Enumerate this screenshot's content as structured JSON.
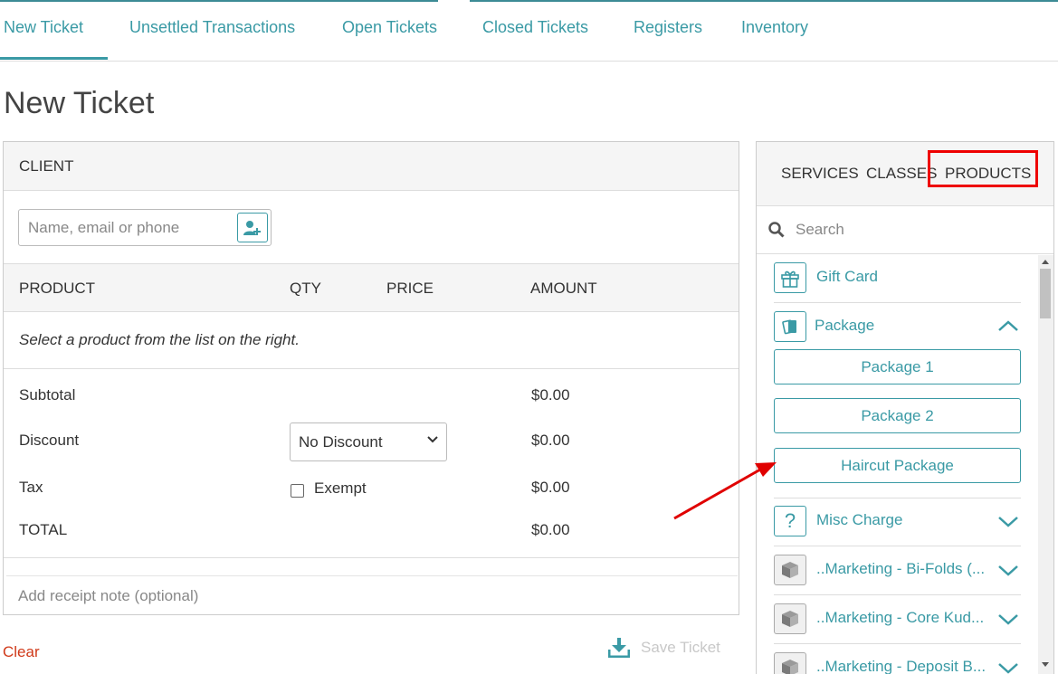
{
  "nav": {
    "tabs": [
      {
        "label": "New Ticket",
        "active": true
      },
      {
        "label": "Unsettled Transactions"
      },
      {
        "label": "Open Tickets"
      },
      {
        "label": "Closed Tickets"
      },
      {
        "label": "Registers"
      },
      {
        "label": "Inventory"
      }
    ]
  },
  "page": {
    "title": "New Ticket"
  },
  "client": {
    "header": "CLIENT",
    "search_placeholder": "Name, email or phone",
    "add_client_icon": "add-user-icon"
  },
  "table": {
    "columns": [
      "PRODUCT",
      "QTY",
      "PRICE",
      "AMOUNT"
    ],
    "empty_message": "Select a product from the list on the right."
  },
  "summary": {
    "subtotal_label": "Subtotal",
    "subtotal_value": "$0.00",
    "discount_label": "Discount",
    "discount_selected": "No Discount",
    "discount_value": "$0.00",
    "tax_label": "Tax",
    "exempt_label": "Exempt",
    "exempt_checked": false,
    "tax_value": "$0.00",
    "total_label": "TOTAL",
    "total_value": "$0.00"
  },
  "receipt": {
    "placeholder": "Add receipt note (optional)"
  },
  "actions": {
    "clear": "Clear",
    "save_ticket": "Save Ticket"
  },
  "catalog": {
    "tabs": [
      {
        "label": "SERVICES"
      },
      {
        "label": "CLASSES"
      },
      {
        "label": "PRODUCTS",
        "active": true
      }
    ],
    "search_placeholder": "Search",
    "categories": [
      {
        "label": "Gift Card",
        "icon": "gift-icon"
      },
      {
        "label": "Package",
        "icon": "cards-icon",
        "expanded": true
      },
      {
        "label": "Misc Charge",
        "icon": "question-icon"
      },
      {
        "label": "..Marketing - Bi-Folds (...",
        "icon": "box-icon"
      },
      {
        "label": "..Marketing - Core Kud...",
        "icon": "box-icon"
      },
      {
        "label": "..Marketing - Deposit B...",
        "icon": "box-icon"
      }
    ],
    "package_items": [
      "Package 1",
      "Package 2",
      "Haircut Package"
    ]
  },
  "colors": {
    "accent": "#3a9aa5",
    "danger": "#d03a1a",
    "annotation": "#e00000"
  }
}
